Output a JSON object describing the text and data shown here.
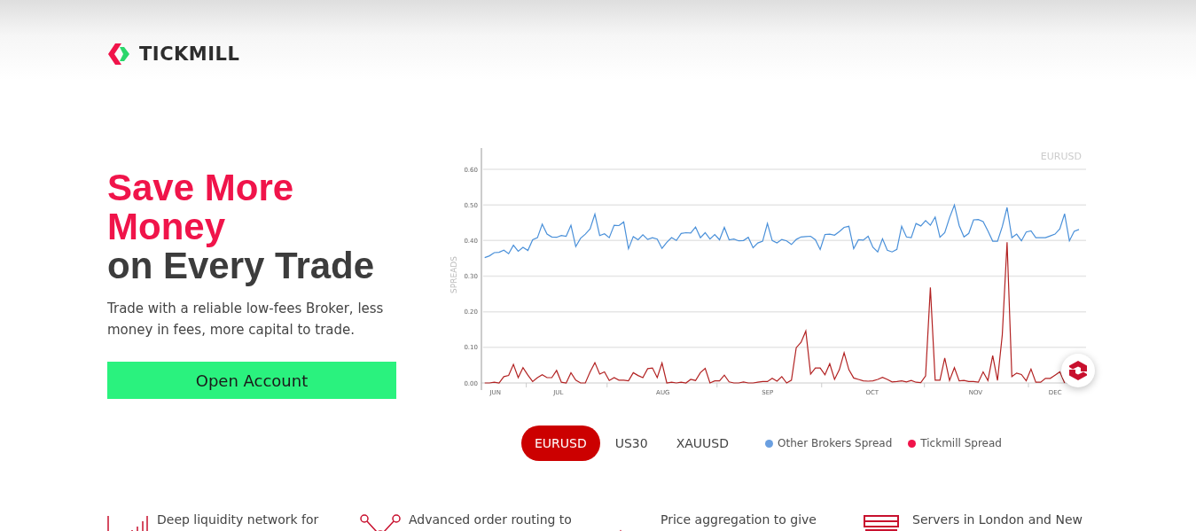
{
  "logo": {
    "text": "TICKMILL"
  },
  "hero": {
    "headline": [
      {
        "text": "Save More",
        "kind": "accent"
      },
      {
        "text": "Money",
        "kind": "accent"
      },
      {
        "text": "on Every Trade",
        "kind": "plain"
      }
    ],
    "subtitle": "Trade with a reliable low-fees Broker, less money in fees, more capital to trade.",
    "cta": "Open Account"
  },
  "chart": {
    "chart_data": {
      "type": "line",
      "title": "EURUSD",
      "ylabel": "SPREADS",
      "grid": true,
      "ylim": [
        0,
        0.66
      ],
      "yticks": [
        {
          "value": 0,
          "label": "0.00"
        },
        {
          "value": 0.1,
          "label": "0.10"
        },
        {
          "value": 0.2,
          "label": "0.20"
        },
        {
          "value": 0.3,
          "label": "0.30"
        },
        {
          "value": 0.4,
          "label": "0.40"
        },
        {
          "value": 0.5,
          "label": "0.50"
        },
        {
          "value": 0.6,
          "label": "0.60"
        }
      ],
      "series": [
        {
          "name": "Other Brokers Spread",
          "color": "#4a90d9",
          "values": [
            0.352,
            0.357,
            0.366,
            0.367,
            0.373,
            0.363,
            0.387,
            0.37,
            0.381,
            0.372,
            0.402,
            0.408,
            0.446,
            0.418,
            0.41,
            0.409,
            0.414,
            0.412,
            0.443,
            0.383,
            0.406,
            0.418,
            0.433,
            0.474,
            0.414,
            0.419,
            0.408,
            0.443,
            0.442,
            0.452,
            0.377,
            0.411,
            0.402,
            0.416,
            0.403,
            0.408,
            0.404,
            0.378,
            0.395,
            0.408,
            0.4,
            0.42,
            0.422,
            0.421,
            0.438,
            0.408,
            0.422,
            0.404,
            0.417,
            0.402,
            0.437,
            0.402,
            0.404,
            0.399,
            0.4,
            0.409,
            0.38,
            0.393,
            0.398,
            0.448,
            0.4,
            0.393,
            0.403,
            0.399,
            0.389,
            0.403,
            0.41,
            0.411,
            0.412,
            0.402,
            0.375,
            0.417,
            0.418,
            0.415,
            0.425,
            0.437,
            0.44,
            0.377,
            0.402,
            0.401,
            0.412,
            0.381,
            0.368,
            0.405,
            0.373,
            0.368,
            0.375,
            0.44,
            0.41,
            0.408,
            0.448,
            0.441,
            0.456,
            0.443,
            0.466,
            0.409,
            0.422,
            0.464,
            0.5,
            0.442,
            0.41,
            0.42,
            0.458,
            0.459,
            0.453,
            0.427,
            0.398,
            0.398,
            0.439,
            0.493,
            0.408,
            0.418,
            0.399,
            0.424,
            0.427,
            0.408,
            0.408,
            0.408,
            0.413,
            0.418,
            0.433,
            0.475,
            0.399,
            0.426,
            0.431
          ]
        },
        {
          "name": "Tickmill Spread",
          "color": "#b22222",
          "values": [
            0,
            0,
            0.002,
            0,
            0.018,
            0.021,
            0.052,
            0.015,
            0.043,
            0.022,
            0.004,
            0.015,
            0.023,
            0.015,
            0.015,
            0.035,
            0.002,
            0,
            0.029,
            0.008,
            0,
            0,
            0.031,
            0.057,
            0.025,
            0.031,
            0.007,
            0.015,
            0.008,
            0.008,
            0.006,
            0.029,
            0.021,
            0.015,
            0.04,
            0.042,
            0.015,
            0.056,
            0,
            0.002,
            0,
            0.002,
            0,
            0.01,
            0.007,
            0.029,
            0.041,
            0,
            0.006,
            0.006,
            0.022,
            0.003,
            0,
            0,
            0.003,
            0,
            0,
            0.002,
            0.004,
            0.004,
            0.013,
            0.005,
            0.018,
            0,
            0.008,
            0.099,
            0.114,
            0.146,
            0.025,
            0.042,
            0.042,
            0.023,
            0.054,
            0.01,
            0.037,
            0.085,
            0.037,
            0.014,
            0.01,
            0.006,
            0.005,
            0.006,
            0.01,
            0.016,
            0.01,
            0.003,
            0.004,
            0.006,
            0.003,
            0.007,
            0.002,
            0.001,
            0.02,
            0.268,
            0.008,
            0.008,
            0.07,
            0.007,
            0.043,
            0.006,
            0.007,
            0.004,
            0.004,
            0.002,
            0.031,
            0.007,
            0.077,
            0.007,
            0.135,
            0.395,
            0.018,
            0.028,
            0.024,
            0.006,
            0.039,
            0.002,
            0.002,
            0.013,
            0.013,
            0.022,
            0.031,
            0,
            null,
            null,
            null
          ]
        }
      ]
    },
    "month_labels": [
      "JUN",
      "JUL",
      "AUG",
      "SEP",
      "OCT",
      "NOV",
      "DEC"
    ],
    "legend": [
      {
        "color": "#6a9fe0"
      },
      {
        "color": "#f0144a"
      }
    ]
  },
  "instruments": [
    {
      "label": "EURUSD",
      "selected": true
    },
    {
      "label": "US30",
      "selected": false
    },
    {
      "label": "XAUUSD",
      "selected": false
    }
  ],
  "features": [
    {
      "kind": "bars",
      "text": "Deep liquidity network for"
    },
    {
      "kind": "network",
      "text": "Advanced order routing to"
    },
    {
      "kind": "triangles",
      "text": "Price aggregation to give"
    },
    {
      "kind": "servers",
      "text": "Servers in London and New"
    }
  ]
}
